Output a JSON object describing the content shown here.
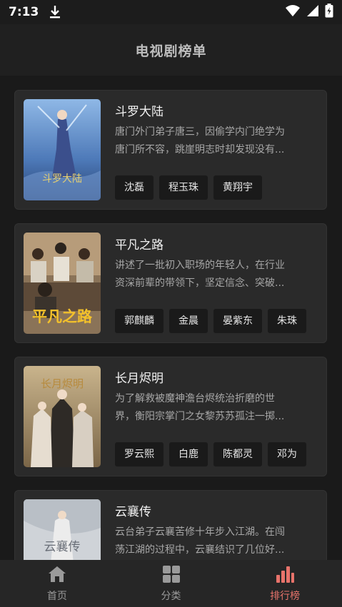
{
  "status": {
    "time": "7:13"
  },
  "header": {
    "title": "电视剧榜单"
  },
  "dramas": [
    {
      "title": "斗罗大陆",
      "desc_line1": "唐门外门弟子唐三，因偷学内门绝学为",
      "desc_line2": "唐门所不容，跳崖明志时却发现没有...",
      "poster_caption": "斗罗大陆",
      "actors": [
        "沈磊",
        "程玉珠",
        "黄翔宇"
      ]
    },
    {
      "title": "平凡之路",
      "desc_line1": "讲述了一批初入职场的年轻人，在行业",
      "desc_line2": "资深前辈的带领下，坚定信念、突破...",
      "poster_caption": "平凡之路",
      "actors": [
        "郭麒麟",
        "金晨",
        "晏紫东",
        "朱珠"
      ]
    },
    {
      "title": "长月烬明",
      "desc_line1": "为了解救被魔神澹台烬统治折磨的世",
      "desc_line2": "界，衡阳宗掌门之女黎苏苏孤注一掷...",
      "poster_caption": "长月烬明",
      "actors": [
        "罗云熙",
        "白鹿",
        "陈都灵",
        "邓为"
      ]
    },
    {
      "title": "云襄传",
      "desc_line1": "云台弟子云襄苦修十年步入江湖。在闯",
      "desc_line2": "荡江湖的过程中，云襄结识了几位好...",
      "poster_caption": "云襄传",
      "actors": []
    }
  ],
  "tabs": [
    {
      "label": "首页",
      "icon": "home-icon"
    },
    {
      "label": "分类",
      "icon": "grid-icon"
    },
    {
      "label": "排行榜",
      "icon": "ranking-icon"
    }
  ],
  "colors": {
    "active_tab": "#e8736b",
    "background": "#1c1c1c",
    "card": "#2a2a2a"
  }
}
